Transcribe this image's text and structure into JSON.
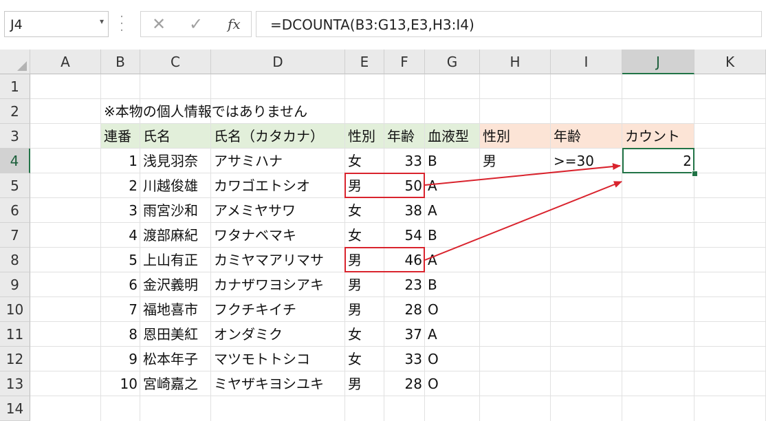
{
  "formula_bar": {
    "name_box": "J4",
    "name_box_dropdown": "▾",
    "cancel_glyph": "✕",
    "enter_glyph": "✓",
    "fx_glyph": "fx",
    "formula": "=DCOUNTA(B3:G13,E3,H3:I4)"
  },
  "columns": [
    "A",
    "B",
    "C",
    "D",
    "E",
    "F",
    "G",
    "H",
    "I",
    "J",
    "K"
  ],
  "rows": [
    "1",
    "2",
    "3",
    "4",
    "5",
    "6",
    "7",
    "8",
    "9",
    "10",
    "11",
    "12",
    "13",
    "14"
  ],
  "note": "※本物の個人情報ではありません",
  "table": {
    "headers": [
      "連番",
      "氏名",
      "氏名（カタカナ）",
      "性別",
      "年齢",
      "血液型"
    ],
    "records": [
      [
        "1",
        "浅見羽奈",
        "アサミハナ",
        "女",
        "33",
        "B"
      ],
      [
        "2",
        "川越俊雄",
        "カワゴエトシオ",
        "男",
        "50",
        "A"
      ],
      [
        "3",
        "雨宮沙和",
        "アメミヤサワ",
        "女",
        "38",
        "A"
      ],
      [
        "4",
        "渡部麻紀",
        "ワタナベマキ",
        "女",
        "54",
        "B"
      ],
      [
        "5",
        "上山有正",
        "カミヤマアリマサ",
        "男",
        "46",
        "A"
      ],
      [
        "6",
        "金沢義明",
        "カナザワヨシアキ",
        "男",
        "23",
        "B"
      ],
      [
        "7",
        "福地喜市",
        "フクチキイチ",
        "男",
        "28",
        "O"
      ],
      [
        "8",
        "恩田美紅",
        "オンダミク",
        "女",
        "37",
        "A"
      ],
      [
        "9",
        "松本年子",
        "マツモトトシコ",
        "女",
        "33",
        "O"
      ],
      [
        "10",
        "宮崎嘉之",
        "ミヤザキヨシユキ",
        "男",
        "28",
        "O"
      ]
    ]
  },
  "criteria": {
    "headers": [
      "性別",
      "年齢",
      "カウント"
    ],
    "values": [
      "男",
      ">=30",
      "2"
    ]
  },
  "colors": {
    "header_green": "#e2efda",
    "header_pink": "#fce4d6",
    "excel_green": "#217346",
    "annotation_red": "#d9232d"
  }
}
